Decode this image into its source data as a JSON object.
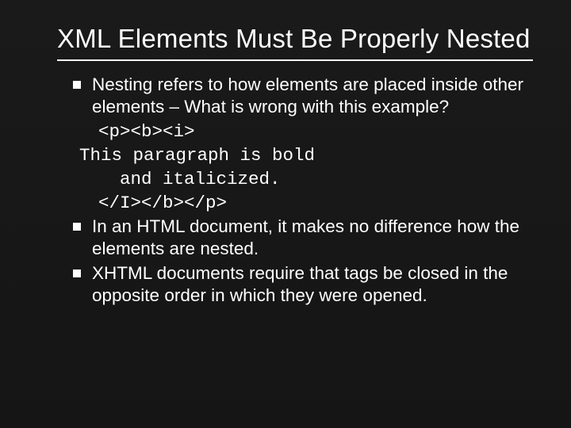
{
  "title": "XML Elements Must Be Properly Nested",
  "bullets": [
    {
      "text": "Nesting refers to how elements are placed inside other elements – What is wrong with this example?"
    },
    {
      "text": "In an HTML document, it makes no difference how the elements are nested."
    },
    {
      "text": "XHTML documents require that tags be closed in the opposite order in which they were opened."
    }
  ],
  "code": {
    "line1": "<p><b><i>",
    "line2": "This paragraph is bold",
    "line3": "  and italicized.",
    "line4": "</I></b></p>"
  }
}
